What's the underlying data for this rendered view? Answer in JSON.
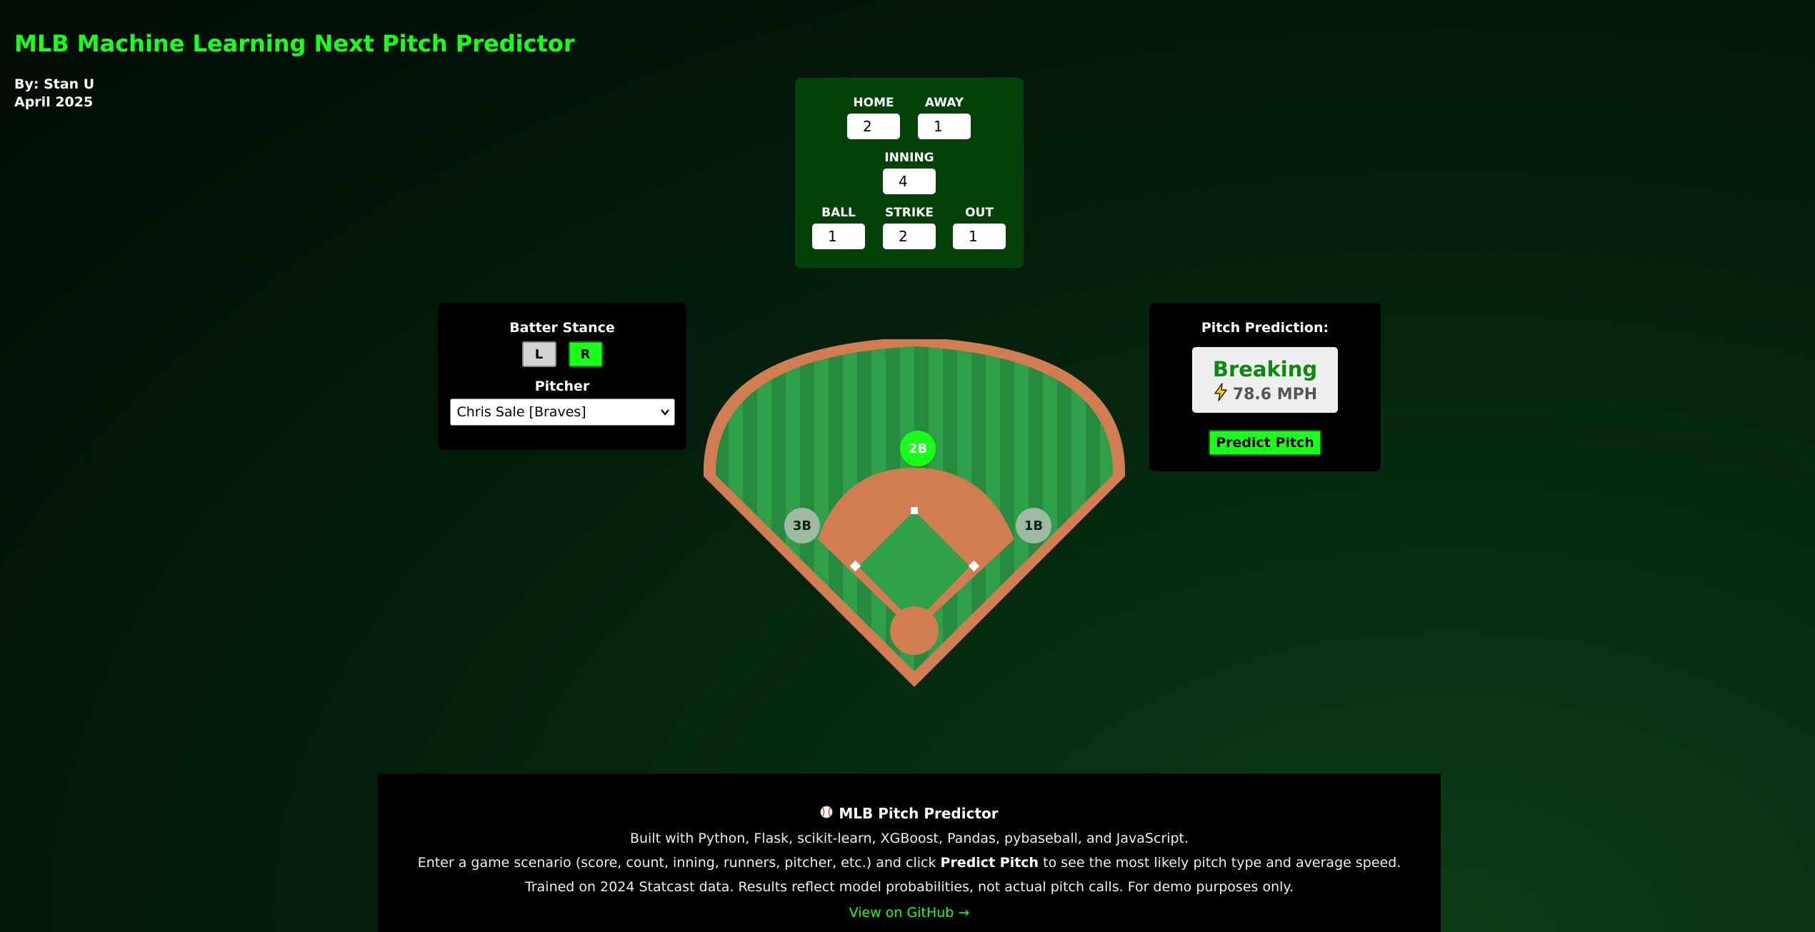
{
  "header": {
    "title": "MLB Machine Learning Next Pitch Predictor",
    "author": "By: Stan U",
    "date": "April 2025"
  },
  "scoreboard": {
    "home_label": "HOME",
    "home_value": "2",
    "away_label": "AWAY",
    "away_value": "1",
    "inning_label": "INNING",
    "inning_value": "4",
    "ball_label": "BALL",
    "ball_value": "1",
    "strike_label": "STRIKE",
    "strike_value": "2",
    "out_label": "OUT",
    "out_value": "1"
  },
  "batter": {
    "stance_label": "Batter Stance",
    "left_label": "L",
    "right_label": "R",
    "selected_stance": "R",
    "pitcher_label": "Pitcher",
    "pitcher_value": "Chris Sale [Braves]"
  },
  "field": {
    "first_base": "1B",
    "second_base": "2B",
    "third_base": "3B",
    "occupied": [
      "2B"
    ]
  },
  "prediction": {
    "label": "Pitch Prediction:",
    "pitch_type": "Breaking",
    "speed": "78.6 MPH",
    "speed_icon": "lightning-icon",
    "button_label": "Predict Pitch"
  },
  "footer": {
    "icon": "baseball-icon",
    "title": "MLB Pitch Predictor",
    "built_with": "Built with Python, Flask, scikit-learn, XGBoost, Pandas, pybaseball, and JavaScript.",
    "instructions_pre": "Enter a game scenario (score, count, inning, runners, pitcher, etc.) and click",
    "instructions_bold": "Predict Pitch",
    "instructions_post": "to see the most likely pitch type and average speed.",
    "disclaimer": "Trained on 2024 Statcast data. Results reflect model probabilities, not actual pitch calls. For demo purposes only.",
    "link": "View on GitHub →"
  },
  "colors": {
    "accent": "#19ff19",
    "scoreboard_bg": "#04420a",
    "dirt": "#d17d51",
    "grass_light": "#2f9f4a",
    "grass_dark": "#268a3f"
  }
}
